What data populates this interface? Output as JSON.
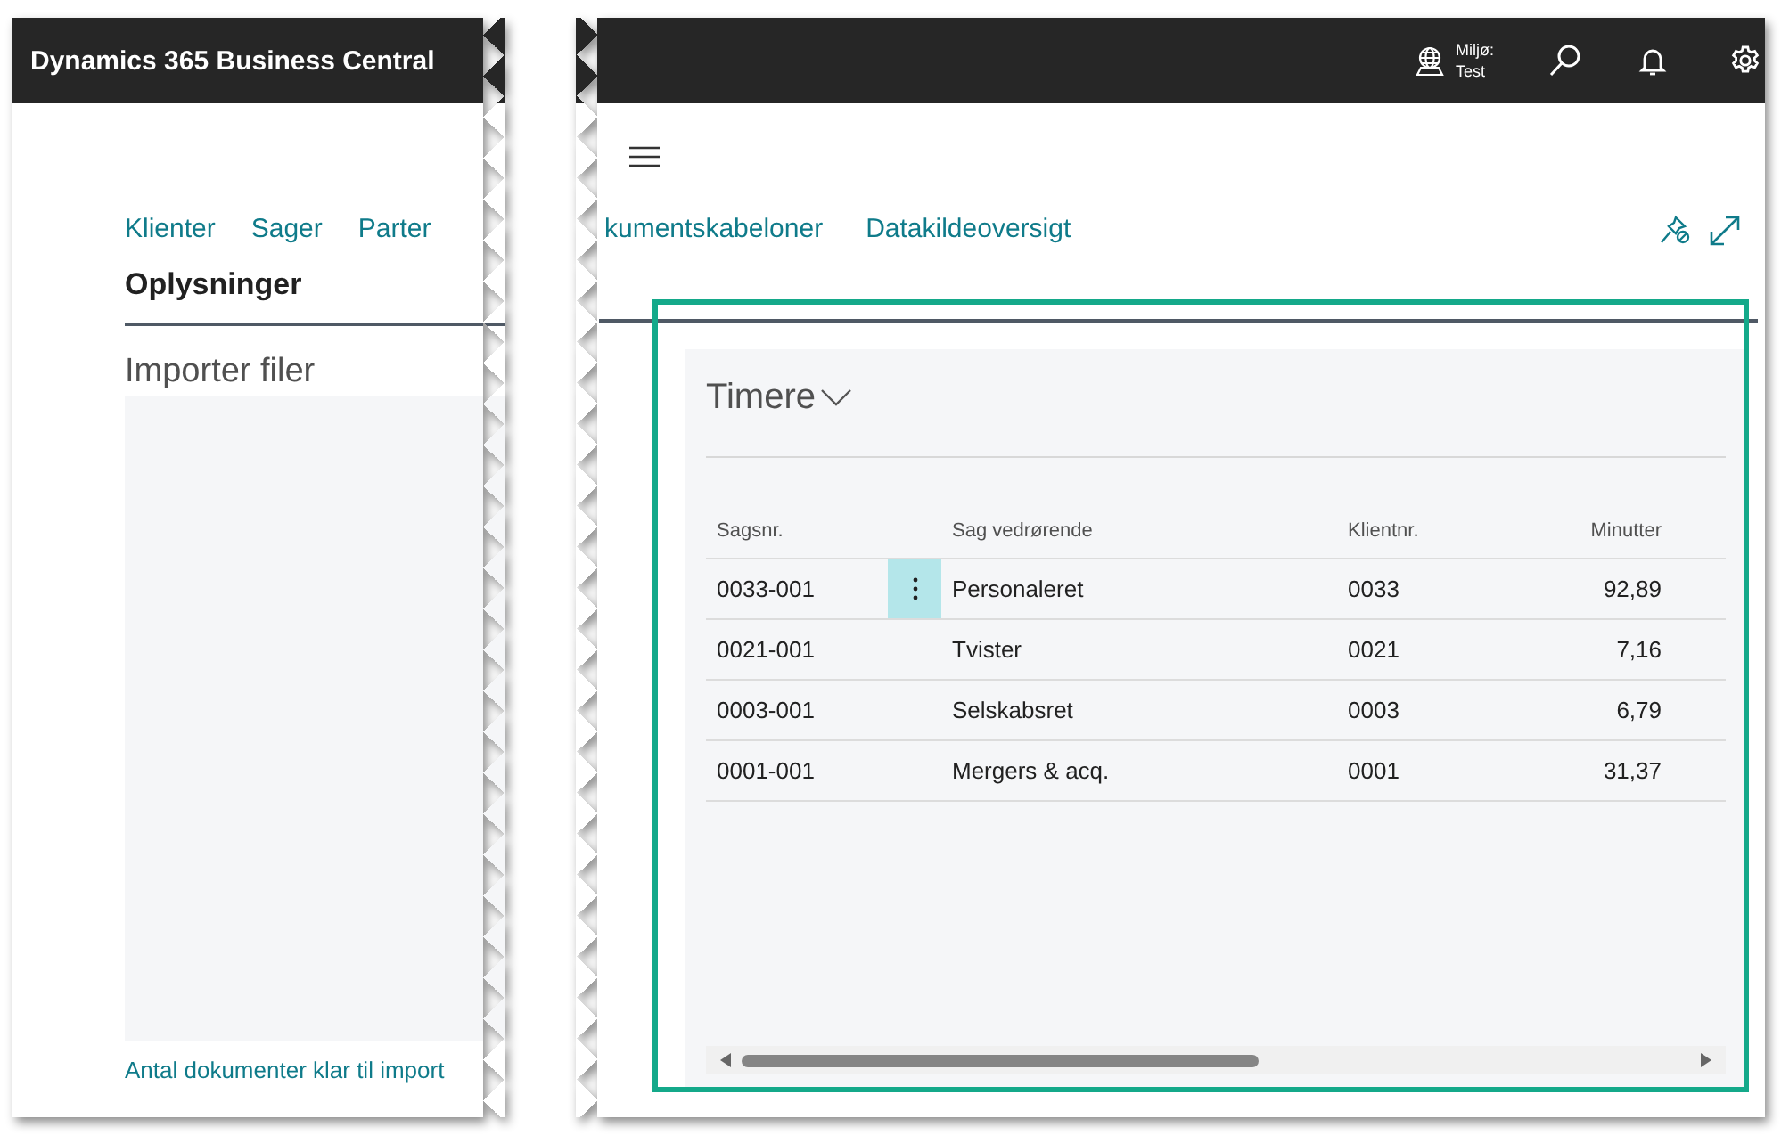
{
  "left_pane": {
    "app_title": "Dynamics 365 Business Central",
    "nav_links": [
      "Klienter",
      "Sager",
      "Parter"
    ],
    "section_title": "Oplysninger",
    "subsection_title": "Importer filer",
    "footer_link": "Antal dokumenter klar til import"
  },
  "right_pane": {
    "environment": {
      "label": "Miljø:",
      "value": "Test"
    },
    "nav_links": [
      "kumentskabeloner",
      "Datakildeoversigt"
    ],
    "part": {
      "title": "Timere",
      "columns": [
        "Sagsnr.",
        "Sag vedrørende",
        "Klientnr.",
        "Minutter"
      ],
      "rows": [
        {
          "cells": [
            "0033-001",
            "Personaleret",
            "0033",
            "92,89"
          ],
          "selected": true
        },
        {
          "cells": [
            "0021-001",
            "Tvister",
            "0021",
            "7,16"
          ],
          "selected": false
        },
        {
          "cells": [
            "0003-001",
            "Selskabsret",
            "0003",
            "6,79"
          ],
          "selected": false
        },
        {
          "cells": [
            "0001-001",
            "Mergers & acq.",
            "0001",
            "31,37"
          ],
          "selected": false
        }
      ]
    }
  }
}
